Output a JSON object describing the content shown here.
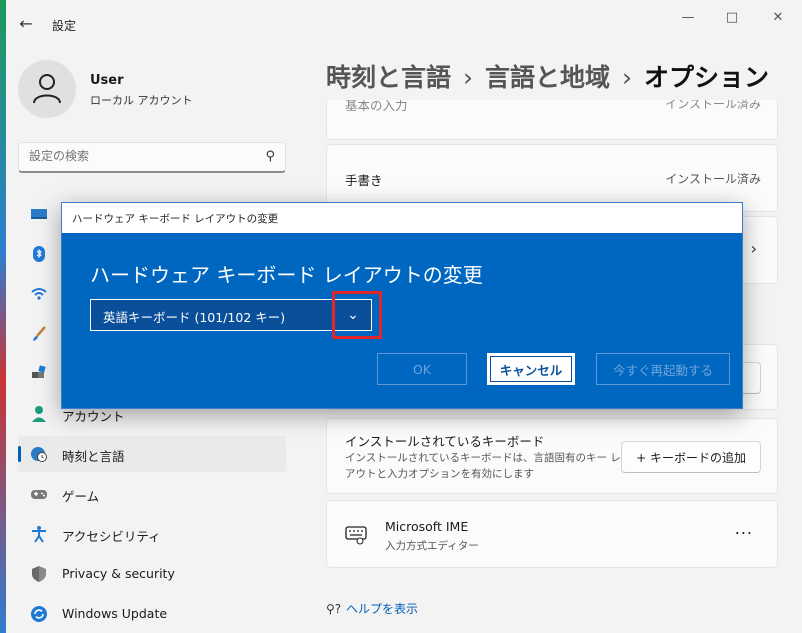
{
  "app": {
    "title": "設定"
  },
  "user": {
    "name": "User",
    "account_type": "ローカル アカウント"
  },
  "search": {
    "placeholder": "設定の検索"
  },
  "nav": {
    "items": [
      {
        "label": ""
      },
      {
        "label": ""
      },
      {
        "label": ""
      },
      {
        "label": ""
      },
      {
        "label": ""
      },
      {
        "label": "アカウント"
      },
      {
        "label": "時刻と言語",
        "selected": true
      },
      {
        "label": "ゲーム"
      },
      {
        "label": "アクセシビリティ"
      },
      {
        "label": "Privacy & security"
      },
      {
        "label": "Windows Update"
      }
    ]
  },
  "breadcrumb": {
    "level1": "時刻と言語",
    "level2": "言語と地域",
    "current": "オプション"
  },
  "cards": {
    "top_partial": {
      "title": "基本の入力",
      "status": "インストール済み"
    },
    "handwriting": {
      "title": "手書き",
      "status": "インストール済み"
    },
    "installed_keyboards": {
      "title": "インストールされているキーボード",
      "description": "インストールされているキーボードは、言語固有のキー レイアウトと入力オプションを有効にします",
      "add_button": "+ キーボードの追加"
    },
    "ime": {
      "title": "Microsoft IME",
      "subtitle": "入力方式エディター",
      "more": "..."
    }
  },
  "help": {
    "label": "ヘルプを表示"
  },
  "dialog": {
    "window_title": "ハードウェア キーボード レイアウトの変更",
    "heading": "ハードウェア キーボード レイアウトの変更",
    "selected_layout": "英語キーボード (101/102 キー)",
    "ok": "OK",
    "cancel": "キャンセル",
    "restart": "今すぐ再起動する"
  },
  "colors": {
    "accent": "#0067c0",
    "highlight": "#e2242d"
  }
}
